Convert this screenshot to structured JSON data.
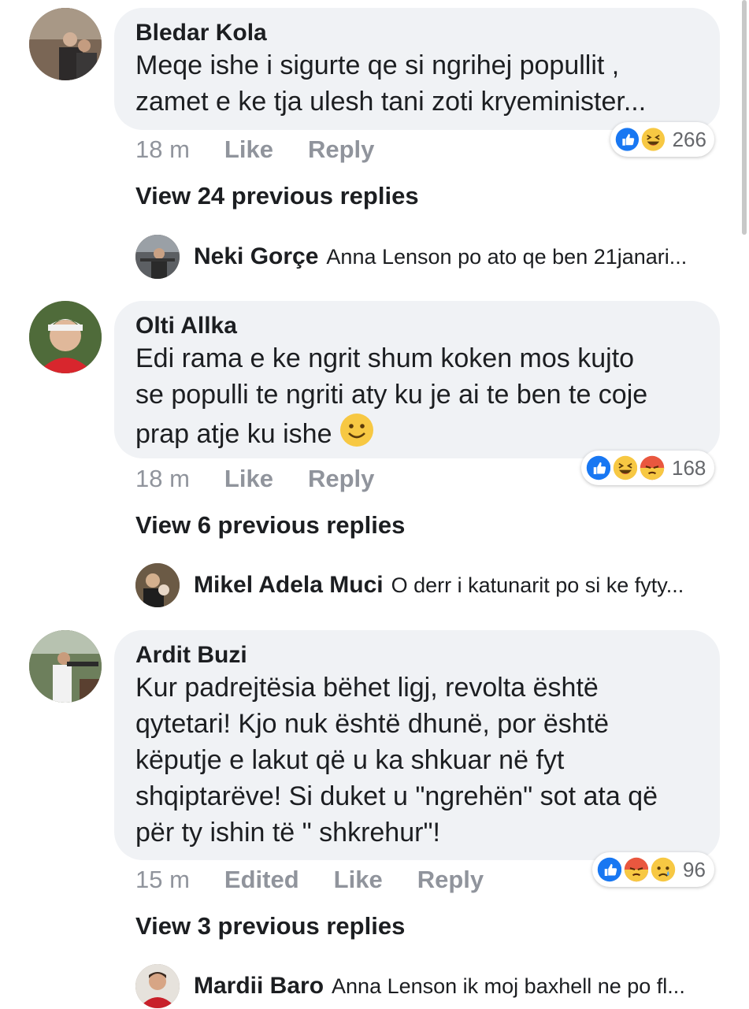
{
  "comments": [
    {
      "author": "Bledar Kola",
      "text_lines": [
        "Meqe ishe i sigurte qe si ngrihej popullit ,",
        "zamet e ke tja ulesh tani zoti kryeminister..."
      ],
      "time": "18 m",
      "like_label": "Like",
      "reply_label": "Reply",
      "reaction_count": "266",
      "reactions": [
        "like-reaction-icon",
        "haha-reaction-icon"
      ],
      "view_replies": "View 24 previous replies",
      "reply": {
        "author": "Neki Gorçe",
        "text": "Anna Lenson po ato qe ben 21janari..."
      }
    },
    {
      "author": "Olti Allka",
      "text_lines": [
        "Edi rama e ke ngrit shum koken mos kujto",
        "se populli te ngriti aty ku je ai te ben te coje",
        "prap atje ku ishe"
      ],
      "time": "18 m",
      "like_label": "Like",
      "reply_label": "Reply",
      "reaction_count": "168",
      "reactions": [
        "like-reaction-icon",
        "haha-reaction-icon",
        "angry-reaction-icon"
      ],
      "view_replies": "View 6 previous replies",
      "reply": {
        "author": "Mikel Adela Muci",
        "text": "O derr i katunarit po si ke fyty..."
      }
    },
    {
      "author": "Ardit Buzi",
      "text_lines": [
        "Kur padrejtësia bëhet ligj, revolta është",
        "qytetari! Kjo nuk është dhunë, por është",
        "këputje e lakut që u ka shkuar në fyt",
        "shqiptarëve! Si duket u \"ngrehën\" sot ata që",
        "për ty ishin të \" shkrehur\"!"
      ],
      "time": "15 m",
      "edited_label": "Edited",
      "like_label": "Like",
      "reply_label": "Reply",
      "reaction_count": "96",
      "reactions": [
        "like-reaction-icon",
        "angry-reaction-icon",
        "sad-reaction-icon"
      ],
      "view_replies": "View 3 previous replies",
      "reply": {
        "author": "Mardii Baro",
        "text": "Anna Lenson ik moj baxhell ne po fl..."
      }
    }
  ],
  "colors": {
    "bubble": "#f0f2f5",
    "meta": "#90949c",
    "like_blue": "#1877f2",
    "emoji_yellow": "#f7c843",
    "angry_red": "#e9573f"
  }
}
